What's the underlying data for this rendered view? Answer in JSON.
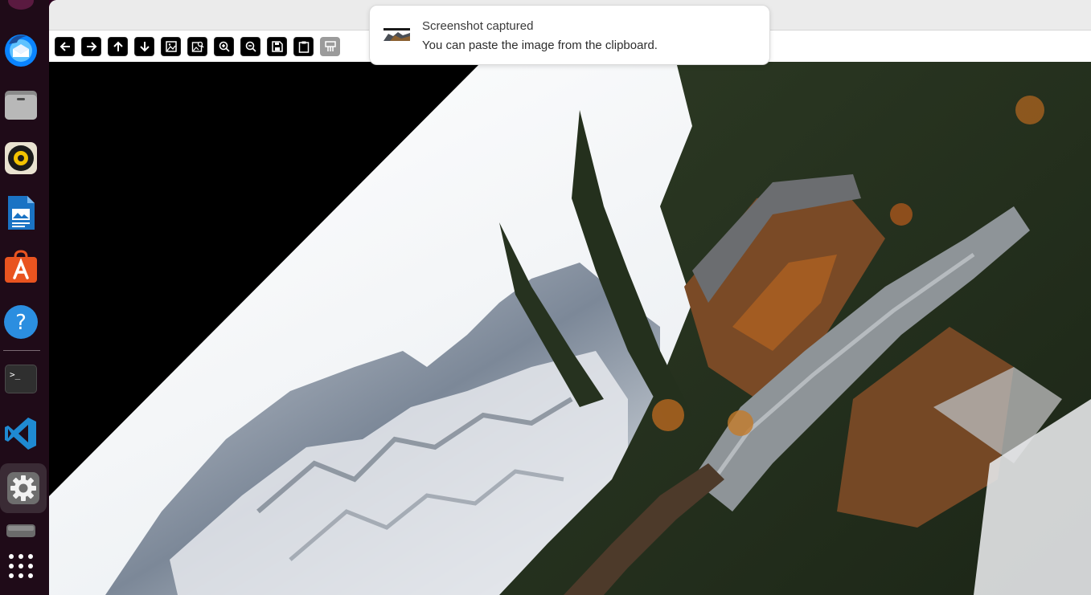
{
  "dock": {
    "items": [
      {
        "name": "thunderbird",
        "icon": "thunderbird-icon"
      },
      {
        "name": "files",
        "icon": "files-icon"
      },
      {
        "name": "rhythmbox",
        "icon": "rhythmbox-icon"
      },
      {
        "name": "libreoffice-writer",
        "icon": "writer-icon"
      },
      {
        "name": "app-center",
        "icon": "app-center-icon"
      },
      {
        "name": "help",
        "icon": "help-icon",
        "glyph": "?"
      },
      {
        "name": "terminal",
        "icon": "terminal-icon",
        "glyph": ">_"
      },
      {
        "name": "vscode",
        "icon": "vscode-icon"
      },
      {
        "name": "settings",
        "icon": "gear-icon"
      },
      {
        "name": "trash",
        "icon": "trash-icon"
      },
      {
        "name": "show-apps",
        "icon": "app-grid-icon"
      }
    ],
    "active": "settings"
  },
  "toolbar": {
    "buttons": [
      {
        "name": "back",
        "icon": "arrow-left-icon"
      },
      {
        "name": "forward",
        "icon": "arrow-right-icon"
      },
      {
        "name": "up",
        "icon": "arrow-up-icon"
      },
      {
        "name": "down",
        "icon": "arrow-down-icon"
      },
      {
        "name": "image",
        "icon": "image-icon"
      },
      {
        "name": "image-search",
        "icon": "image-search-icon"
      },
      {
        "name": "zoom-in",
        "icon": "zoom-in-icon"
      },
      {
        "name": "zoom-out",
        "icon": "zoom-out-icon"
      },
      {
        "name": "save",
        "icon": "save-icon"
      },
      {
        "name": "clipboard",
        "icon": "clipboard-icon"
      },
      {
        "name": "paint",
        "icon": "paint-roller-icon"
      }
    ]
  },
  "notification": {
    "title": "Screenshot captured",
    "body": "You can paste the image from the clipboard."
  },
  "colors": {
    "dock_bg": "#1f0b18",
    "accent_orange": "#e95420",
    "vscode_blue": "#1f8ad2"
  }
}
